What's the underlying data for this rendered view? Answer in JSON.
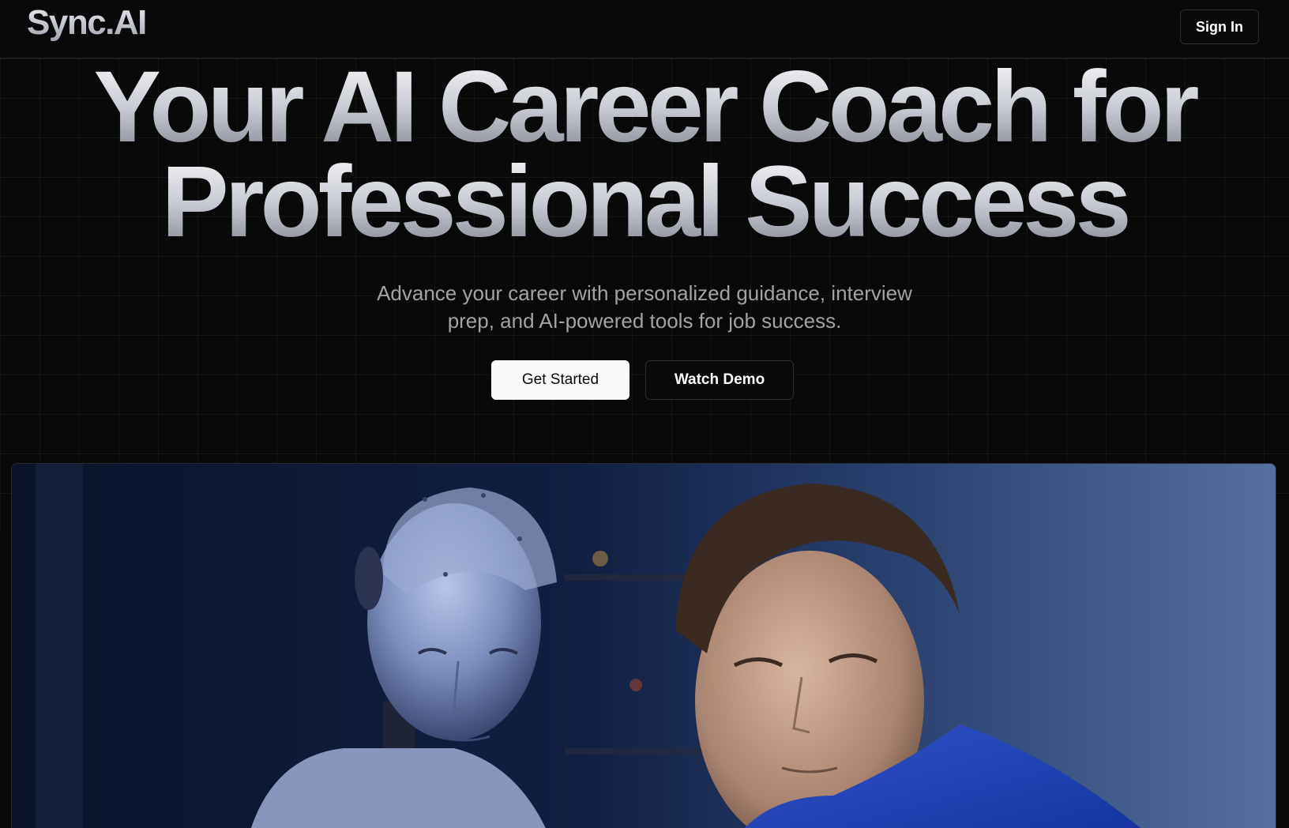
{
  "header": {
    "logo": "Sync.AI",
    "signin_label": "Sign In"
  },
  "hero": {
    "headline_line1": "Your AI Career Coach for",
    "headline_line2": "Professional Success",
    "subtitle_line1": "Advance your career with personalized guidance, interview",
    "subtitle_line2": "prep, and AI-powered tools for job success.",
    "primary_cta": "Get Started",
    "secondary_cta": "Watch Demo"
  },
  "image": {
    "icon": "hero-photo-robot-and-man"
  },
  "colors": {
    "background": "#090909",
    "primary_button_bg": "#fafafa",
    "subtitle_text": "#a3a3a3"
  }
}
